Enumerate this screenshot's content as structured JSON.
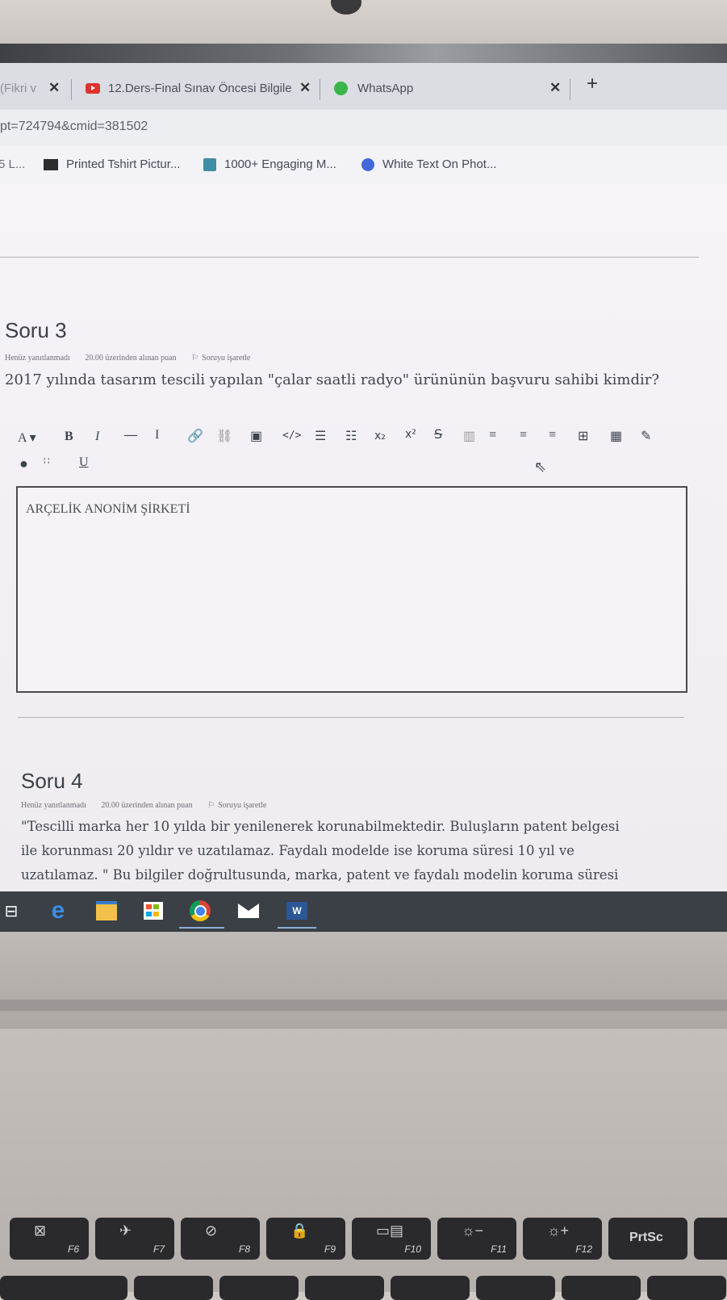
{
  "browser": {
    "tabs": [
      {
        "label": "(Fikri v",
        "close": "✕"
      },
      {
        "label": "12.Ders-Final Sınav Öncesi Bilgile",
        "close": "✕"
      },
      {
        "label": "WhatsApp",
        "close": "✕"
      }
    ],
    "new_tab": "+",
    "url": "pt=724794&cmid=381502",
    "bookmarks": [
      {
        "label": "5 L..."
      },
      {
        "label": "Printed Tshirt Pictur..."
      },
      {
        "label": "1000+ Engaging M..."
      },
      {
        "label": "White Text On Phot..."
      }
    ]
  },
  "question3": {
    "title": "Soru 3",
    "status": "Henüz yanıtlanmadı",
    "points": "20.00 üzerinden alınan puan",
    "flag": "Soruyu işaretle",
    "text": "2017 yılında tasarım tescili yapılan \"çalar saatli radyo\" ürününün başvuru sahibi kimdir?",
    "answer": "ARÇELİK ANONİM ŞİRKETİ"
  },
  "toolbar": {
    "font": "A ▾",
    "bold": "B",
    "italic": "I",
    "underline": "U",
    "subscript": "x₂",
    "superscript": "x²"
  },
  "question4": {
    "title": "Soru 4",
    "status": "Henüz yanıtlanmadı",
    "points": "20.00 üzerinden alınan puan",
    "flag": "Soruyu işaretle",
    "line1": "\"Tescilli marka her 10 yılda bir yenilenerek korunabilmektedir. Buluşların patent belgesi",
    "line2": "ile korunması 20 yıldır ve uzatılamaz. Faydalı modelde ise koruma süresi 10 yıl ve",
    "line3": "uzatılamaz. \" Bu bilgiler doğrultusunda, marka, patent ve faydalı modelin koruma süresi"
  },
  "taskbar": {
    "word_label": "W"
  },
  "keyboard": {
    "keys": [
      "F6",
      "F7",
      "F8",
      "F9",
      "F10",
      "F11",
      "F12",
      "PrtSc"
    ]
  },
  "colors": {
    "youtube": "#e0322e",
    "whatsapp": "#3ab54a",
    "editor_border": "#4c4a4e",
    "taskbar": "#3b3f46"
  }
}
